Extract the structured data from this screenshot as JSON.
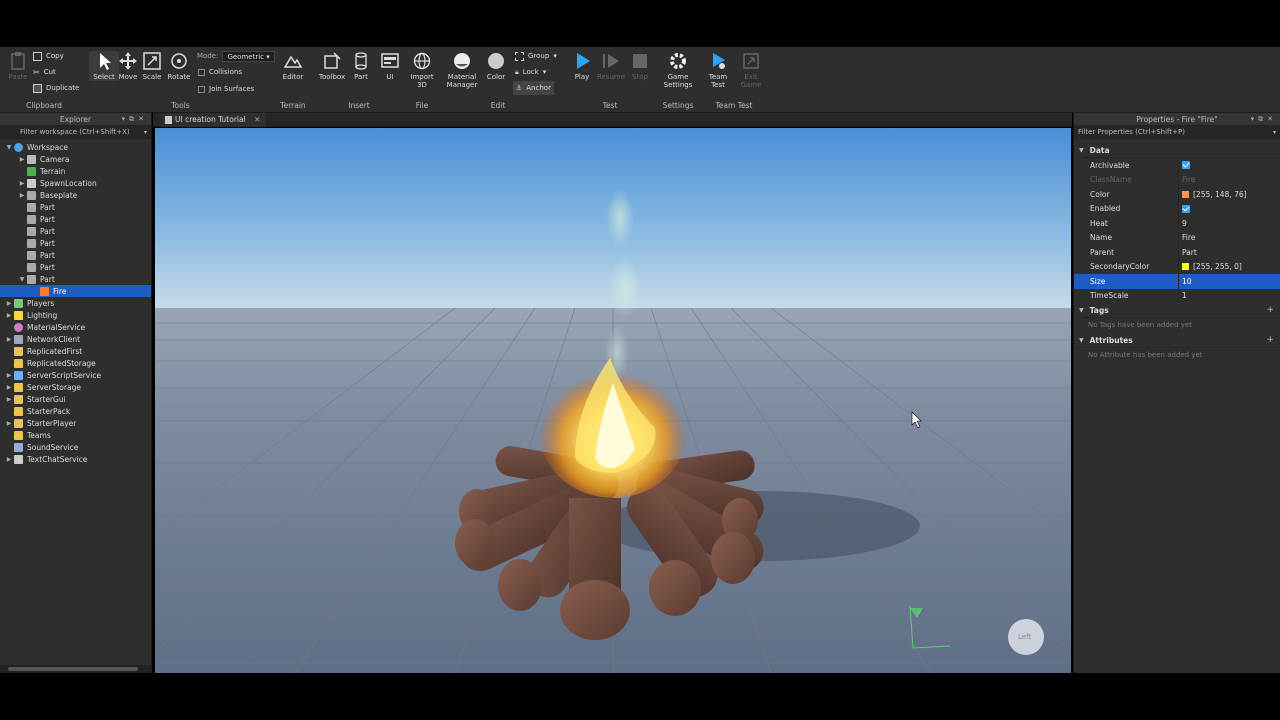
{
  "ribbon": {
    "clipboard": {
      "paste_label": "Paste",
      "copy_label": "Copy",
      "cut_label": "Cut",
      "duplicate_label": "Duplicate",
      "group_label": "Clipboard"
    },
    "tools": {
      "select_label": "Select",
      "move_label": "Move",
      "scale_label": "Scale",
      "rotate_label": "Rotate",
      "mode_label": "Mode:",
      "mode_value": "Geometric",
      "collisions_label": "Collisions",
      "join_surfaces_label": "Join Surfaces",
      "group_label": "Tools"
    },
    "terrain": {
      "editor_label": "Editor",
      "group_label": "Terrain"
    },
    "insert": {
      "toolbox_label": "Toolbox",
      "part_label": "Part",
      "ui_label": "UI",
      "group_label": "Insert"
    },
    "file": {
      "import3d_label": "Import 3D",
      "group_label": "File"
    },
    "edit": {
      "material_manager_label": "Material Manager",
      "color_label": "Color",
      "group_btn_label": "Group",
      "lock_label": "Lock",
      "anchor_label": "Anchor",
      "group_label": "Edit"
    },
    "test": {
      "play_label": "Play",
      "resume_label": "Resume",
      "stop_label": "Stop",
      "group_label": "Test"
    },
    "settings": {
      "game_settings_label": "Game Settings",
      "group_label": "Settings"
    },
    "team_test": {
      "team_test_label": "Team Test",
      "exit_game_label": "Exit Game",
      "group_label": "Team Test"
    }
  },
  "explorer": {
    "title": "Explorer",
    "filter_placeholder": "Filter workspace (Ctrl+Shift+X)",
    "items": [
      {
        "label": "Workspace",
        "icon": "globe-icon"
      },
      {
        "label": "Camera",
        "icon": "camera-icon"
      },
      {
        "label": "Terrain",
        "icon": "terrain-icon"
      },
      {
        "label": "SpawnLocation",
        "icon": "spawn-icon"
      },
      {
        "label": "Baseplate",
        "icon": "part-icon"
      },
      {
        "label": "Part",
        "icon": "part-icon"
      },
      {
        "label": "Part",
        "icon": "part-icon"
      },
      {
        "label": "Part",
        "icon": "part-icon"
      },
      {
        "label": "Part",
        "icon": "part-icon"
      },
      {
        "label": "Part",
        "icon": "part-icon"
      },
      {
        "label": "Part",
        "icon": "part-icon"
      },
      {
        "label": "Part",
        "icon": "part-icon"
      },
      {
        "label": "Fire",
        "icon": "fire-icon"
      },
      {
        "label": "Players",
        "icon": "players-icon"
      },
      {
        "label": "Lighting",
        "icon": "bulb-icon"
      },
      {
        "label": "MaterialService",
        "icon": "material-icon"
      },
      {
        "label": "NetworkClient",
        "icon": "network-icon"
      },
      {
        "label": "ReplicatedFirst",
        "icon": "folder-icon"
      },
      {
        "label": "ReplicatedStorage",
        "icon": "folder-icon"
      },
      {
        "label": "ServerScriptService",
        "icon": "script-service-icon"
      },
      {
        "label": "ServerStorage",
        "icon": "folder-icon"
      },
      {
        "label": "StarterGui",
        "icon": "gui-icon"
      },
      {
        "label": "StarterPack",
        "icon": "pack-icon"
      },
      {
        "label": "StarterPlayer",
        "icon": "player-icon"
      },
      {
        "label": "Teams",
        "icon": "teams-icon"
      },
      {
        "label": "SoundService",
        "icon": "sound-icon"
      },
      {
        "label": "TextChatService",
        "icon": "chat-icon"
      }
    ]
  },
  "document": {
    "tab_label": "UI creation Tutorial",
    "view_cube_label": "Left"
  },
  "properties": {
    "title": "Properties - Fire \"Fire\"",
    "filter_placeholder": "Filter Properties (Ctrl+Shift+P)",
    "data_section": "Data",
    "rows": {
      "archivable": {
        "name": "Archivable"
      },
      "classname": {
        "name": "ClassName",
        "value": "Fire"
      },
      "color": {
        "name": "Color",
        "value": "[255, 148, 76]",
        "swatch": "#ff944c"
      },
      "enabled": {
        "name": "Enabled"
      },
      "heat": {
        "name": "Heat",
        "value": "9"
      },
      "name": {
        "name": "Name",
        "value": "Fire"
      },
      "parent": {
        "name": "Parent",
        "value": "Part"
      },
      "secondary_color": {
        "name": "SecondaryColor",
        "value": "[255, 255, 0]",
        "swatch": "#ffff00"
      },
      "size": {
        "name": "Size",
        "value": "10"
      },
      "timescale": {
        "name": "TimeScale",
        "value": "1"
      }
    },
    "tags_section": "Tags",
    "tags_empty": "No Tags have been added yet",
    "attributes_section": "Attributes",
    "attributes_empty": "No Attribute has been added yet"
  },
  "colors": {
    "accent": "#1c5cc3",
    "panel_bg": "#2e2e2e",
    "play_blue": "#2ba5ff"
  }
}
